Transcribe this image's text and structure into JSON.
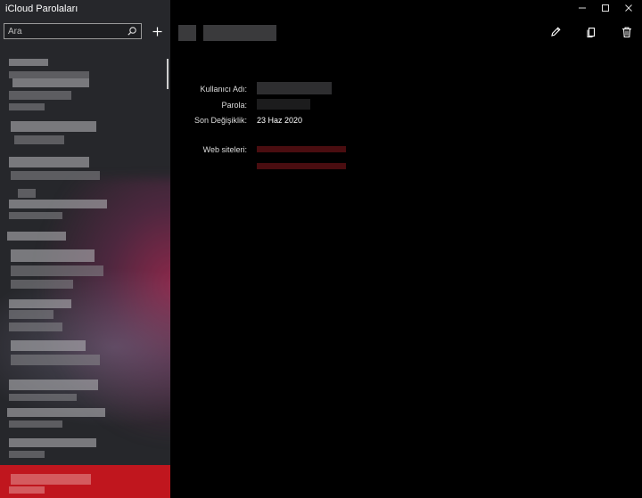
{
  "app": {
    "title": "iCloud Parolaları"
  },
  "search": {
    "placeholder": "Ara"
  },
  "icons": {
    "search": "search-icon",
    "add": "plus-icon",
    "edit": "pencil-icon",
    "copy": "copy-icon",
    "delete": "trash-icon",
    "minimize": "minimize-icon",
    "maximize": "maximize-icon",
    "close": "close-icon"
  },
  "detail": {
    "username_label": "Kullanıcı Adı:",
    "password_label": "Parola:",
    "modified_label": "Son Değişiklik:",
    "modified_value": "23 Haz 2020",
    "websites_label": "Web siteleri:"
  },
  "colors": {
    "sidebar_bg": "#26272b",
    "main_bg": "#000000",
    "selection": "#c0161e",
    "link": "#4a0d10"
  }
}
